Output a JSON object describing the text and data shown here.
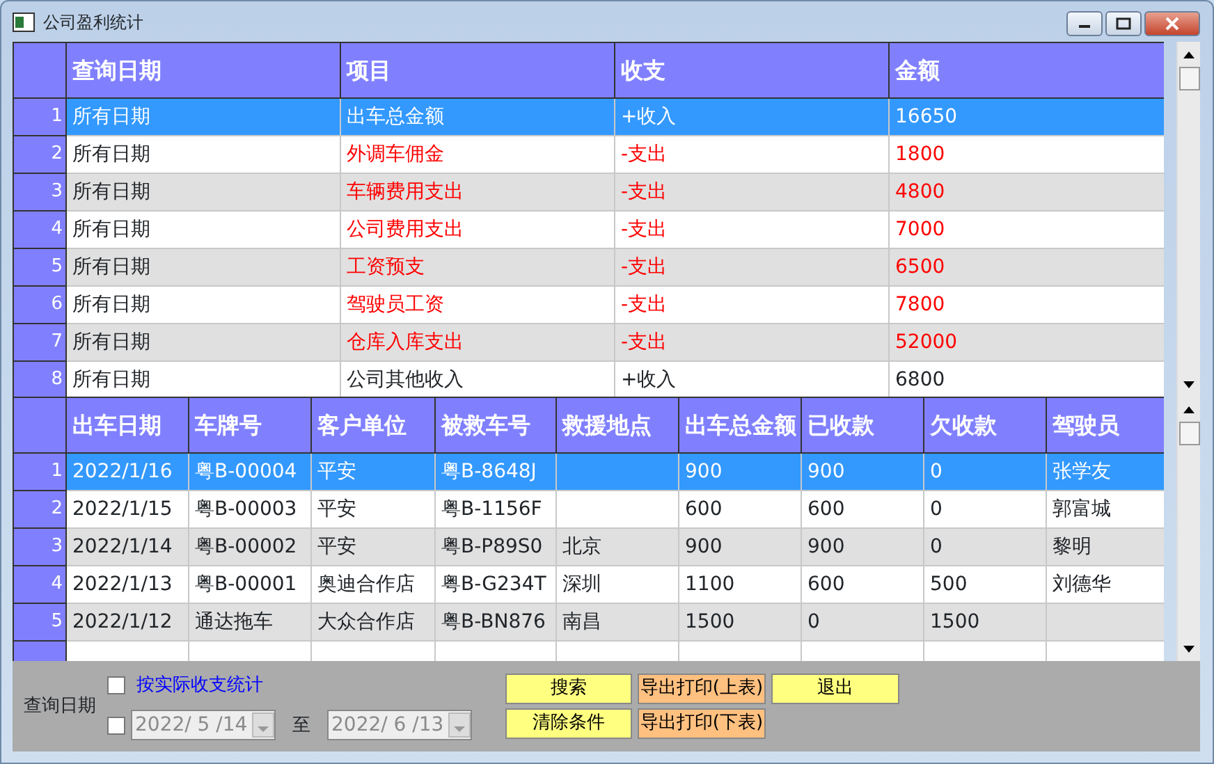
{
  "window": {
    "title": "公司盈利统计"
  },
  "summary_table": {
    "columns": [
      "查询日期",
      "项目",
      "收支",
      "金额"
    ],
    "rows": [
      {
        "index": "1",
        "kind": "income",
        "selected": true,
        "cells": [
          "所有日期",
          "出车总金额",
          "+收入",
          "16650"
        ]
      },
      {
        "index": "2",
        "kind": "expense",
        "selected": false,
        "cells": [
          "所有日期",
          "外调车佣金",
          "-支出",
          "1800"
        ]
      },
      {
        "index": "3",
        "kind": "expense",
        "selected": false,
        "cells": [
          "所有日期",
          "车辆费用支出",
          "-支出",
          "4800"
        ]
      },
      {
        "index": "4",
        "kind": "expense",
        "selected": false,
        "cells": [
          "所有日期",
          "公司费用支出",
          "-支出",
          "7000"
        ]
      },
      {
        "index": "5",
        "kind": "expense",
        "selected": false,
        "cells": [
          "所有日期",
          "工资预支",
          "-支出",
          "6500"
        ]
      },
      {
        "index": "6",
        "kind": "expense",
        "selected": false,
        "cells": [
          "所有日期",
          "驾驶员工资",
          "-支出",
          "7800"
        ]
      },
      {
        "index": "7",
        "kind": "expense",
        "selected": false,
        "cells": [
          "所有日期",
          "仓库入库支出",
          "-支出",
          "52000"
        ]
      },
      {
        "index": "8",
        "kind": "income",
        "selected": false,
        "cells": [
          "所有日期",
          "公司其他收入",
          "+收入",
          "6800"
        ]
      }
    ]
  },
  "detail_table": {
    "columns": [
      "出车日期",
      "车牌号",
      "客户单位",
      "被救车号",
      "救援地点",
      "出车总金额",
      "已收款",
      "欠收款",
      "驾驶员"
    ],
    "rows": [
      {
        "index": "1",
        "selected": true,
        "cells": [
          "2022/1/16",
          "粤B-00004",
          "平安",
          "粤B-8648J",
          "",
          "900",
          "900",
          "0",
          "张学友"
        ]
      },
      {
        "index": "2",
        "selected": false,
        "cells": [
          "2022/1/15",
          "粤B-00003",
          "平安",
          "粤B-1156F",
          "",
          "600",
          "600",
          "0",
          "郭富城"
        ]
      },
      {
        "index": "3",
        "selected": false,
        "cells": [
          "2022/1/14",
          "粤B-00002",
          "平安",
          "粤B-P89S0",
          "北京",
          "900",
          "900",
          "0",
          "黎明"
        ]
      },
      {
        "index": "4",
        "selected": false,
        "cells": [
          "2022/1/13",
          "粤B-00001",
          "奥迪合作店",
          "粤B-G234T",
          "深圳",
          "1100",
          "600",
          "500",
          "刘德华"
        ]
      },
      {
        "index": "5",
        "selected": false,
        "cells": [
          "2022/1/12",
          "通达拖车",
          "大众合作店",
          "粤B-BN876",
          "南昌",
          "1500",
          "0",
          "1500",
          ""
        ]
      }
    ]
  },
  "filters": {
    "actual_stats": {
      "label": "按实际收支统计",
      "checked": false
    },
    "date_label": "查询日期",
    "date_enabled": {
      "checked": false
    },
    "from_date": {
      "value": "2022/ 5 /14",
      "disabled": true
    },
    "to_label": "至",
    "to_date": {
      "value": "2022/ 6 /13",
      "disabled": true
    }
  },
  "buttons": [
    {
      "label": "搜索",
      "kind": "action"
    },
    {
      "label": "导出打印(上表)",
      "kind": "export"
    },
    {
      "label": "退出",
      "kind": "action"
    },
    {
      "label": "清除条件",
      "kind": "action"
    },
    {
      "label": "导出打印(下表)",
      "kind": "export"
    }
  ]
}
